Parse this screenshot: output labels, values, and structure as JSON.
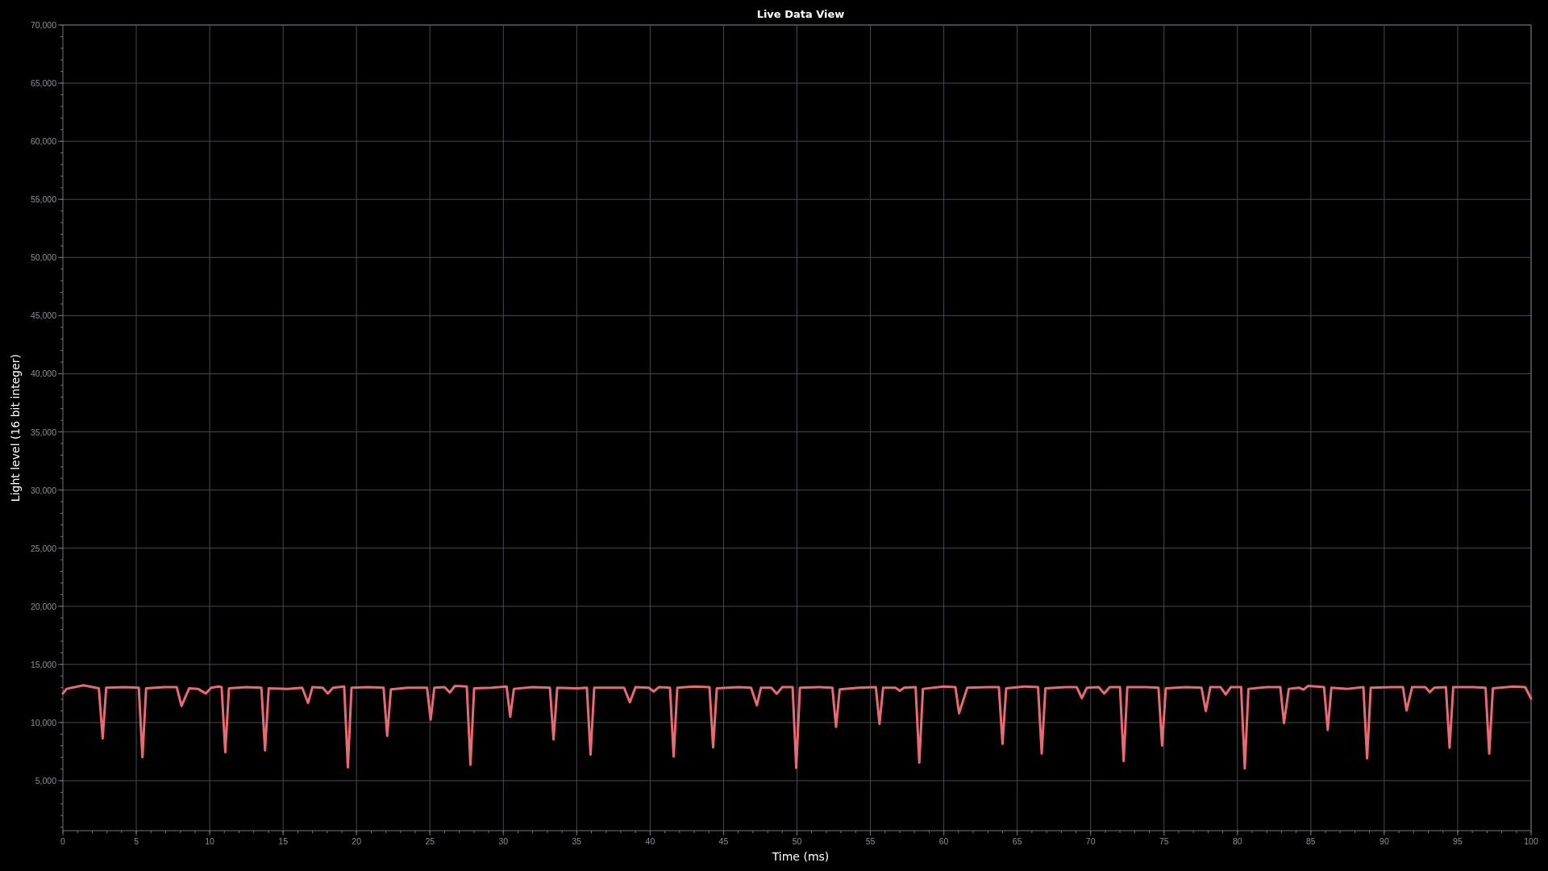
{
  "plot": {
    "chart_data": {
      "type": "line",
      "title": "Live Data View",
      "xlabel": "Time (ms)",
      "ylabel": "Light level (16 bit integer)",
      "grid": true,
      "xlim": [
        0,
        100
      ],
      "ylim": [
        700,
        70000
      ],
      "xticks": [
        0,
        5,
        10,
        15,
        20,
        25,
        30,
        35,
        40,
        45,
        50,
        55,
        60,
        65,
        70,
        75,
        80,
        85,
        90,
        95,
        100
      ],
      "yticks": [
        {
          "value": 5000,
          "label": "5,000"
        },
        {
          "value": 10000,
          "label": "10,000"
        },
        {
          "value": 15000,
          "label": "15,000"
        },
        {
          "value": 20000,
          "label": "20,000"
        },
        {
          "value": 25000,
          "label": "25,000"
        },
        {
          "value": 30000,
          "label": "30,000"
        },
        {
          "value": 35000,
          "label": "35,000"
        },
        {
          "value": 40000,
          "label": "40,000"
        },
        {
          "value": 45000,
          "label": "45,000"
        },
        {
          "value": 50000,
          "label": "50,000"
        },
        {
          "value": 55000,
          "label": "55,000"
        },
        {
          "value": 60000,
          "label": "60,000"
        },
        {
          "value": 65000,
          "label": "65,000"
        },
        {
          "value": 70000,
          "label": "70,000"
        }
      ],
      "x": [
        0,
        0.25,
        1.4,
        2.45,
        2.71,
        2.95,
        4.2,
        5.17,
        5.42,
        5.67,
        6.9,
        7.75,
        8.08,
        8.6,
        9.2,
        9.73,
        10.1,
        10.6,
        10.81,
        11.06,
        11.31,
        12.5,
        13.52,
        13.77,
        14.02,
        15.3,
        16.3,
        16.7,
        17.0,
        17.7,
        18.05,
        18.4,
        19.16,
        19.41,
        19.66,
        20.8,
        21.84,
        22.09,
        22.34,
        23.5,
        24.8,
        25.05,
        25.3,
        26.0,
        26.35,
        26.7,
        27.51,
        27.76,
        28.01,
        29.2,
        30.22,
        30.47,
        30.72,
        32.0,
        33.17,
        33.42,
        33.67,
        35.0,
        35.69,
        35.94,
        36.19,
        37.5,
        38.22,
        38.62,
        39.0,
        39.9,
        40.25,
        40.6,
        41.35,
        41.6,
        41.85,
        43.0,
        44.04,
        44.29,
        44.54,
        46.0,
        46.87,
        47.27,
        47.55,
        48.25,
        48.62,
        49.0,
        49.7,
        49.95,
        50.2,
        51.5,
        52.41,
        52.66,
        52.91,
        54.2,
        55.37,
        55.62,
        55.87,
        56.7,
        57.0,
        57.3,
        58.08,
        58.33,
        58.58,
        60.0,
        60.79,
        61.04,
        61.6,
        63.0,
        63.75,
        64.0,
        64.25,
        65.5,
        66.42,
        66.67,
        66.92,
        68.3,
        69.05,
        69.4,
        69.75,
        70.55,
        70.92,
        71.3,
        72.0,
        72.25,
        72.5,
        73.8,
        74.62,
        74.87,
        75.12,
        76.5,
        77.55,
        77.85,
        78.15,
        78.85,
        79.2,
        79.55,
        80.25,
        80.5,
        80.75,
        82.0,
        82.92,
        83.17,
        83.5,
        84.2,
        84.5,
        84.8,
        85.9,
        86.15,
        86.4,
        87.5,
        88.58,
        88.83,
        89.08,
        90.5,
        91.27,
        91.52,
        91.9,
        92.8,
        93.1,
        93.4,
        94.2,
        94.45,
        94.7,
        96.0,
        96.9,
        97.15,
        97.4,
        98.8,
        99.6,
        100
      ],
      "series": [
        {
          "color": "#e86a75",
          "values": [
            12500,
            12900,
            13200,
            12950,
            8630,
            13000,
            13050,
            13000,
            7020,
            12950,
            13050,
            13050,
            11430,
            12950,
            12900,
            12500,
            13000,
            13100,
            13050,
            7450,
            12950,
            13050,
            13000,
            7600,
            12950,
            12900,
            13000,
            11680,
            13050,
            13000,
            12500,
            13000,
            13100,
            6150,
            13000,
            13050,
            13000,
            8850,
            12850,
            13000,
            13000,
            10250,
            13000,
            13050,
            12580,
            13150,
            13100,
            6370,
            12950,
            13000,
            13100,
            10500,
            12900,
            13050,
            13000,
            8540,
            13000,
            12950,
            13000,
            7240,
            13000,
            13000,
            13000,
            11740,
            13050,
            13000,
            12670,
            13050,
            13000,
            7080,
            13000,
            13100,
            13050,
            7860,
            12950,
            13050,
            13000,
            11490,
            13000,
            13000,
            12480,
            13050,
            13050,
            6090,
            13000,
            13050,
            13000,
            9630,
            12850,
            13000,
            13050,
            9880,
            13000,
            13000,
            12730,
            13000,
            13050,
            6550,
            12900,
            13100,
            13050,
            10800,
            13000,
            13050,
            13050,
            8170,
            12950,
            13100,
            13050,
            7330,
            12950,
            13050,
            13050,
            12100,
            13000,
            13050,
            12500,
            13050,
            13050,
            6680,
            13050,
            13050,
            13000,
            8020,
            12950,
            13050,
            13000,
            10990,
            13050,
            13050,
            12420,
            13050,
            13050,
            6040,
            12900,
            13050,
            13050,
            9950,
            12900,
            13000,
            12830,
            13150,
            13050,
            9370,
            13000,
            12900,
            13050,
            6920,
            13000,
            13050,
            13050,
            11040,
            13050,
            13050,
            12610,
            13000,
            13050,
            7830,
            13050,
            13050,
            13000,
            7330,
            12950,
            13100,
            13050,
            12060
          ]
        }
      ]
    }
  }
}
